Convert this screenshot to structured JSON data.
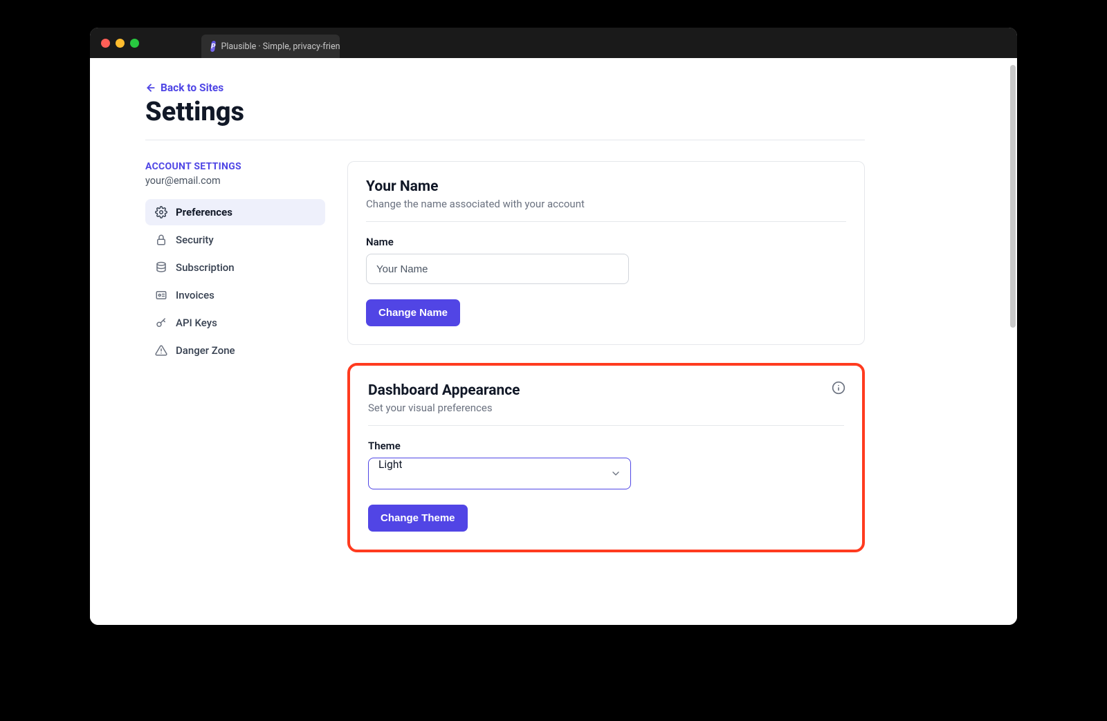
{
  "window": {
    "tab_title": "Plausible · Simple, privacy-frien"
  },
  "header": {
    "back_link": "Back to Sites",
    "title": "Settings"
  },
  "sidebar": {
    "heading": "ACCOUNT SETTINGS",
    "email": "your@email.com",
    "items": [
      {
        "label": "Preferences"
      },
      {
        "label": "Security"
      },
      {
        "label": "Subscription"
      },
      {
        "label": "Invoices"
      },
      {
        "label": "API Keys"
      },
      {
        "label": "Danger Zone"
      }
    ]
  },
  "cards": {
    "name": {
      "title": "Your Name",
      "desc": "Change the name associated with your account",
      "field_label": "Name",
      "field_value": "Your Name",
      "button": "Change Name"
    },
    "appearance": {
      "title": "Dashboard Appearance",
      "desc": "Set your visual preferences",
      "field_label": "Theme",
      "field_value": "Light",
      "button": "Change Theme"
    }
  }
}
